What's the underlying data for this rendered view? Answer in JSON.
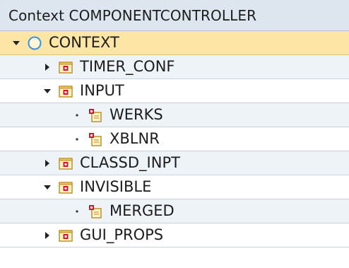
{
  "header": {
    "title": "Context COMPONENTCONTROLLER"
  },
  "tree": {
    "nodes": [
      {
        "label": "CONTEXT",
        "icon": "context-root-icon",
        "toggle": "expanded",
        "selected": true
      },
      {
        "label": "TIMER_CONF",
        "icon": "node-folder-icon",
        "toggle": "collapsed"
      },
      {
        "label": "INPUT",
        "icon": "node-folder-icon",
        "toggle": "expanded"
      },
      {
        "label": "WERKS",
        "icon": "attribute-icon",
        "toggle": "leaf"
      },
      {
        "label": "XBLNR",
        "icon": "attribute-icon",
        "toggle": "leaf"
      },
      {
        "label": "CLASSD_INPT",
        "icon": "node-folder-icon",
        "toggle": "collapsed"
      },
      {
        "label": "INVISIBLE",
        "icon": "node-folder-icon",
        "toggle": "expanded"
      },
      {
        "label": "MERGED",
        "icon": "attribute-icon",
        "toggle": "leaf"
      },
      {
        "label": "GUI_PROPS",
        "icon": "node-folder-icon",
        "toggle": "collapsed"
      }
    ]
  },
  "colors": {
    "header_bg": "#dde6ef",
    "selected_bg": "#fbe6a6",
    "alt_row_bg": "#eef3f8",
    "icon_red": "#d0152b",
    "context_ring": "#3d8fe0"
  }
}
